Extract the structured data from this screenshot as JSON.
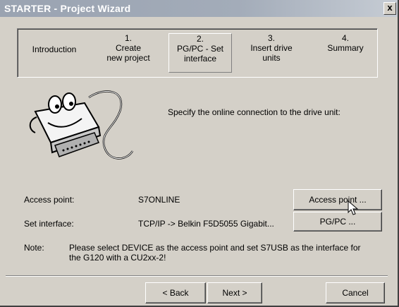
{
  "window": {
    "title": "STARTER - Project Wizard",
    "close_label": "x"
  },
  "steps": [
    {
      "num": "",
      "label": "Introduction"
    },
    {
      "num": "1.",
      "label": "Create\nnew project"
    },
    {
      "num": "2.",
      "label": "PG/PC - Set\ninterface",
      "active": true
    },
    {
      "num": "3.",
      "label": "Insert drive\nunits"
    },
    {
      "num": "4.",
      "label": "Summary"
    }
  ],
  "main": {
    "instruction": "Specify the online connection to the drive unit:",
    "access_point_label": "Access point:",
    "access_point_value": "S7ONLINE",
    "access_point_button": "Access point ...",
    "interface_label": "Set interface:",
    "interface_value": "TCP/IP -> Belkin F5D5055 Gigabit...",
    "interface_button": "PG/PC ...",
    "note_label": "Note:",
    "note_text": "Please select DEVICE as the access point and set S7USB as the interface for the G120 with a CU2xx-2!"
  },
  "footer": {
    "back_label": "< Back",
    "next_label": "Next >",
    "cancel_label": "Cancel"
  },
  "colors": {
    "dialog_bg": "#d4d0c8",
    "title_text": "#ffffff"
  },
  "icons": {
    "mascot": "cable-connector-mascot-icon",
    "cursor": "mouse-pointer-icon"
  }
}
